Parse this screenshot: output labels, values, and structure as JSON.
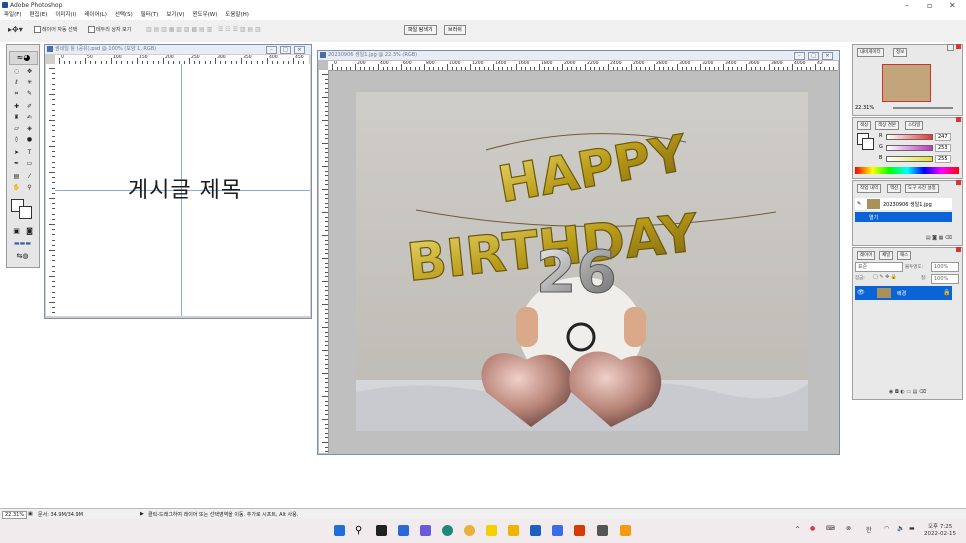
{
  "app": {
    "title": "Adobe Photoshop"
  },
  "menu": [
    "파일(F)",
    "편집(E)",
    "이미지(I)",
    "레이어(L)",
    "선택(S)",
    "필터(T)",
    "보기(V)",
    "윈도우(W)",
    "도움말(H)"
  ],
  "options": {
    "auto_select_layer": "레이어 자동 선택",
    "show_bounding_box": "테두리 상자 보기",
    "file_browser_tab": "파일 탐색기",
    "brushes_tab": "브러쉬"
  },
  "doc1": {
    "title": "썸네일 틀 (공유).psd @ 100% (모양 1, RGB)",
    "ruler_labels": [
      "0",
      "50",
      "100",
      "150",
      "200",
      "250",
      "300",
      "350",
      "400",
      "450"
    ],
    "canvas_text": "게시글 제목"
  },
  "doc2": {
    "title": "20230906 생일1.jpg @ 22.3% (RGB)",
    "ruler_labels": [
      "0",
      "200",
      "400",
      "600",
      "800",
      "1000",
      "1200",
      "1400",
      "1600",
      "1800",
      "2000",
      "2200",
      "2400",
      "2600",
      "2800",
      "3000",
      "3200",
      "3400",
      "3600",
      "3800",
      "4000",
      "42"
    ]
  },
  "navigator": {
    "tabs": [
      "내비게이터",
      "정보"
    ],
    "zoom": "22.31%"
  },
  "color_panel": {
    "tabs": [
      "색상",
      "색상 견본",
      "스타일"
    ],
    "channels": [
      {
        "label": "R",
        "value": "247",
        "color": "#f03333"
      },
      {
        "label": "G",
        "value": "253",
        "color": "#c033c0"
      },
      {
        "label": "B",
        "value": "255",
        "color": "#e0e033"
      }
    ]
  },
  "history_panel": {
    "tabs": [
      "작업 내역",
      "액션",
      "도구 사전 설정"
    ],
    "snapshot": "20230906 생일1.jpg",
    "step": "열기"
  },
  "layers_panel": {
    "tabs": [
      "레이어",
      "채널",
      "패스"
    ],
    "blend_mode": "표준",
    "opacity_label": "불투명도:",
    "opacity": "100%",
    "lock_label": "잠금:",
    "fill_label": "칠:",
    "fill": "100%",
    "layer_name": "배경"
  },
  "status": {
    "zoom": "22.31%",
    "doc_size": "문서: 34.9M/34.9M",
    "hint": "클릭-드래그하여 레이어 또는 선택영역을 이동. 추가로 시프트, Alt 사용."
  },
  "taskbar": {
    "time": "오후 7:25",
    "date": "2022-02-15",
    "lang": "한"
  },
  "photo_text": {
    "line1": "HAPPY",
    "line2": "BIRTHDAY",
    "number": "26"
  },
  "colors": {
    "accent": "#1e5fd0",
    "selection": "#0a64d8"
  }
}
